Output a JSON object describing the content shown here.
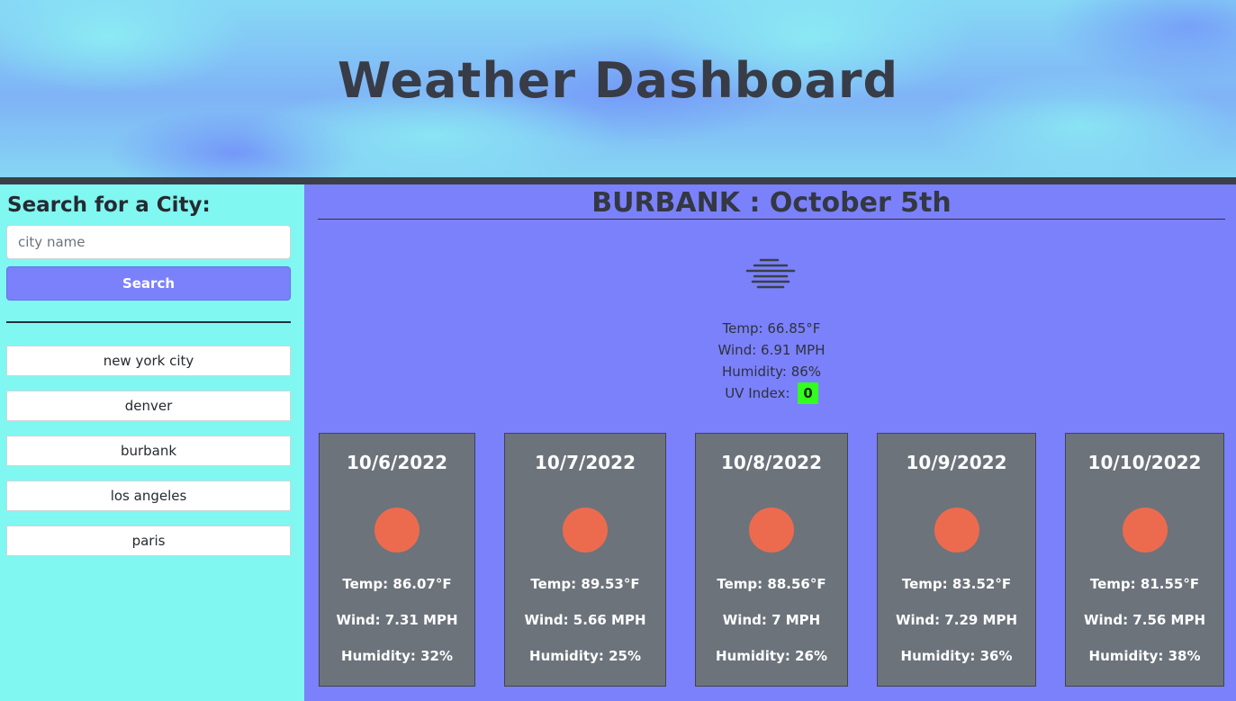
{
  "header": {
    "title": "Weather Dashboard"
  },
  "sidebar": {
    "heading": "Search for a City:",
    "search_placeholder": "city name",
    "search_value": "",
    "search_button_label": "Search",
    "history": [
      "new york city",
      "denver",
      "burbank",
      "los angeles",
      "paris"
    ]
  },
  "current": {
    "title": "BURBANK : October 5th",
    "icon": "fog-icon",
    "temp": "Temp: 66.85°F",
    "wind": "Wind: 6.91 MPH",
    "humidity": "Humidity: 86%",
    "uv_label": "UV Index:",
    "uv_value": "0",
    "uv_color": "#33ff1f"
  },
  "forecast": [
    {
      "date": "10/6/2022",
      "icon": "sun-icon",
      "temp": "Temp: 86.07°F",
      "wind": "Wind: 7.31 MPH",
      "humidity": "Humidity: 32%"
    },
    {
      "date": "10/7/2022",
      "icon": "sun-icon",
      "temp": "Temp: 89.53°F",
      "wind": "Wind: 5.66 MPH",
      "humidity": "Humidity: 25%"
    },
    {
      "date": "10/8/2022",
      "icon": "sun-icon",
      "temp": "Temp: 88.56°F",
      "wind": "Wind: 7 MPH",
      "humidity": "Humidity: 26%"
    },
    {
      "date": "10/9/2022",
      "icon": "sun-icon",
      "temp": "Temp: 83.52°F",
      "wind": "Wind: 7.29 MPH",
      "humidity": "Humidity: 36%"
    },
    {
      "date": "10/10/2022",
      "icon": "sun-icon",
      "temp": "Temp: 81.55°F",
      "wind": "Wind: 7.56 MPH",
      "humidity": "Humidity: 38%"
    }
  ],
  "colors": {
    "accent": "#7b81fb",
    "sidebar_bg": "#80f7f1",
    "card_bg": "#6c737b",
    "sun": "#ec6b4f"
  }
}
